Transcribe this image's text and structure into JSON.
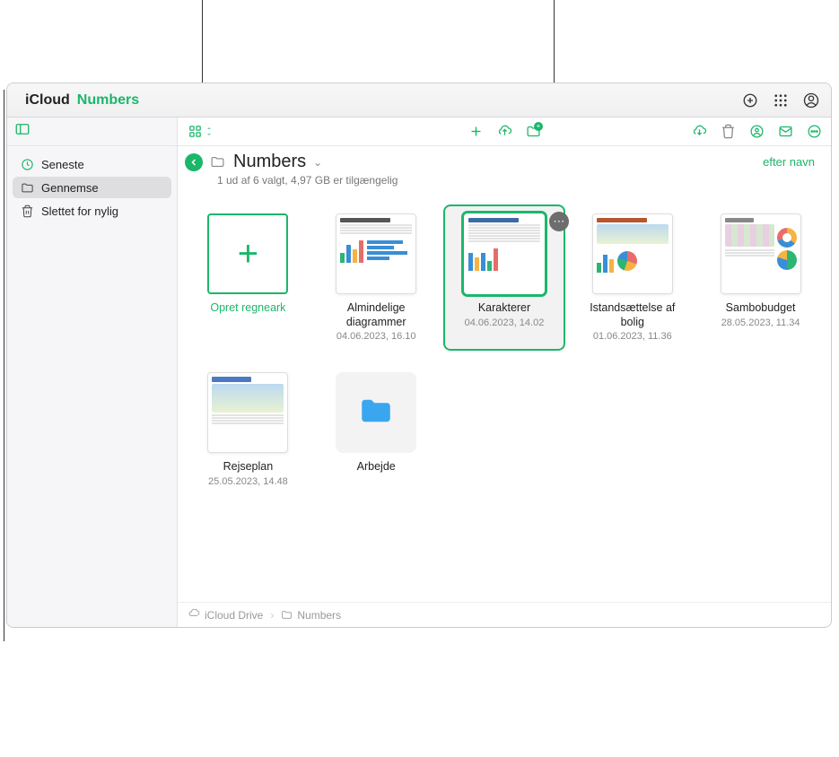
{
  "titlebar": {
    "prefix": "iCloud",
    "app": "Numbers"
  },
  "sidebar": {
    "items": [
      {
        "key": "recents",
        "label": "Seneste"
      },
      {
        "key": "browse",
        "label": "Gennemse"
      },
      {
        "key": "recently-deleted",
        "label": "Slettet for nylig"
      }
    ]
  },
  "header": {
    "title": "Numbers",
    "subtitle": "1 ud af 6 valgt, 4,97 GB er tilgængelig",
    "sort_label": "efter navn"
  },
  "tiles": {
    "create_label": "Opret regneark",
    "items": [
      {
        "name": "Almindelige diagrammer",
        "date": "04.06.2023, 16.10",
        "kind": "charts"
      },
      {
        "name": "Karakterer",
        "date": "04.06.2023, 14.02",
        "kind": "grades",
        "selected": true
      },
      {
        "name": "Istandsættelse af bolig",
        "date": "01.06.2023, 11.36",
        "kind": "reno"
      },
      {
        "name": "Sambobudget",
        "date": "28.05.2023, 11.34",
        "kind": "budget"
      },
      {
        "name": "Rejseplan",
        "date": "25.05.2023, 14.48",
        "kind": "travel"
      },
      {
        "name": "Arbejde",
        "date": "",
        "kind": "folder"
      }
    ]
  },
  "breadcrumb": {
    "root": "iCloud Drive",
    "current": "Numbers"
  }
}
